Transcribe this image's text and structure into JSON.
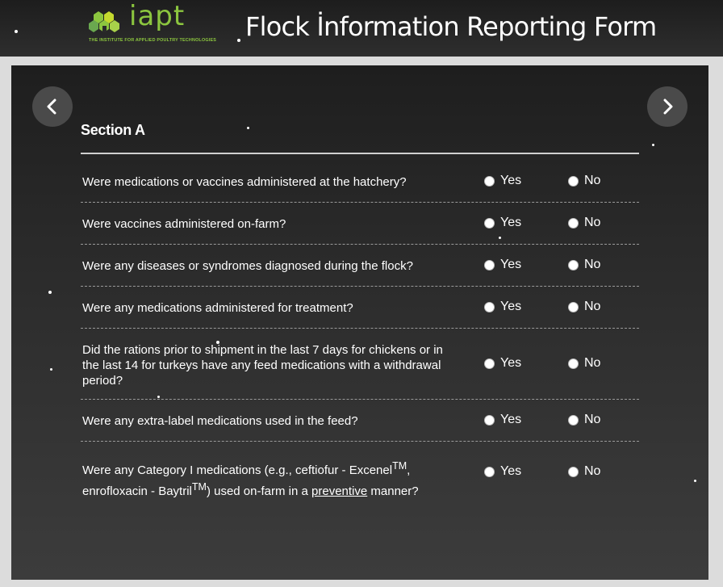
{
  "header": {
    "logo_text": "iapt",
    "logo_tagline": "THE INSTITUTE FOR APPLIED POULTRY TECHNOLOGIES",
    "title": "Flock İnformation Reporting Form"
  },
  "section": {
    "title": "Section A"
  },
  "options": {
    "yes": "Yes",
    "no": "No"
  },
  "questions": [
    {
      "text": "Were medications or vaccines administered at the hatchery?"
    },
    {
      "text": "Were vaccines administered on-farm?"
    },
    {
      "text": "Were any diseases or syndromes diagnosed during the flock?"
    },
    {
      "text": "Were any medications administered for treatment?"
    },
    {
      "text": "Did the rations prior to shipment in the last 7 days for chickens or in the last 14 for turkeys have any feed medications with a withdrawal period?"
    },
    {
      "text": "Were any extra-label medications used in the feed?"
    },
    {
      "text_part1": "Were any Category I medications (e.g., ceftiofur - Excenel",
      "sup1": "TM",
      "text_part2": ",",
      "text_part3": "enrofloxacin - Baytril",
      "sup2": "TM",
      "text_part4": ") used on-farm in a ",
      "underlined": "preventive",
      "text_part5": " manner?"
    }
  ],
  "colors": {
    "brand_green": "#8cc63f",
    "panel_bg": "#2a2a2a",
    "header_bg": "#262626"
  },
  "icons": {
    "prev": "chevron-left-icon",
    "next": "chevron-right-icon"
  }
}
